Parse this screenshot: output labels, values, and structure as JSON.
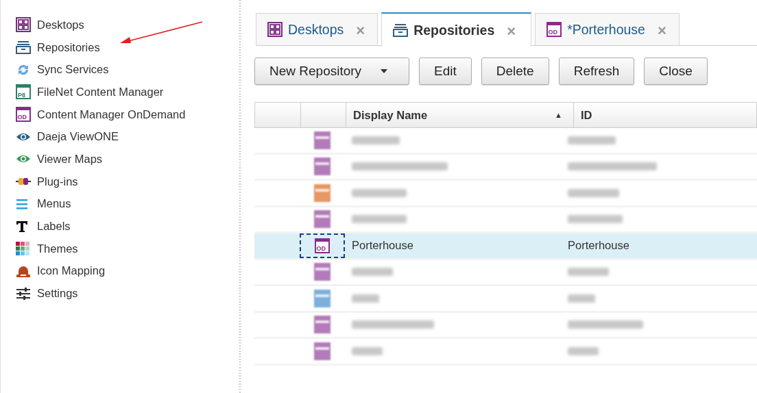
{
  "sidebar": {
    "items": [
      {
        "label": "Desktops",
        "kind": "desktops"
      },
      {
        "label": "Repositories",
        "kind": "repo"
      },
      {
        "label": "Sync Services",
        "kind": "sync"
      },
      {
        "label": "FileNet Content Manager",
        "kind": "p8",
        "icon_text": "P8"
      },
      {
        "label": "Content Manager OnDemand",
        "kind": "od",
        "icon_text": "OD"
      },
      {
        "label": "Daeja ViewONE",
        "kind": "eye"
      },
      {
        "label": "Viewer Maps",
        "kind": "eyegreen"
      },
      {
        "label": "Plug-ins",
        "kind": "plug"
      },
      {
        "label": "Menus",
        "kind": "menu"
      },
      {
        "label": "Labels",
        "kind": "label"
      },
      {
        "label": "Themes",
        "kind": "themes"
      },
      {
        "label": "Icon Mapping",
        "kind": "hat"
      },
      {
        "label": "Settings",
        "kind": "settings"
      }
    ]
  },
  "tabs": [
    {
      "label": "Desktops",
      "close": "×",
      "kind": "desktops",
      "selected": false
    },
    {
      "label": "Repositories",
      "close": "×",
      "kind": "repo",
      "selected": true
    },
    {
      "label": "*Porterhouse",
      "close": "×",
      "kind": "od",
      "icon_text": "OD",
      "selected": false
    }
  ],
  "toolbar": {
    "buttons": [
      {
        "label": "New Repository",
        "kind": "dropdown"
      },
      {
        "label": "Edit",
        "kind": "plain"
      },
      {
        "label": "Delete",
        "kind": "plain"
      },
      {
        "label": "Refresh",
        "kind": "plain"
      },
      {
        "label": "Close",
        "kind": "plain"
      }
    ]
  },
  "table": {
    "columns": [
      {
        "label": "Display Name",
        "sort": "▲"
      },
      {
        "label": "ID"
      }
    ],
    "rows": [
      {
        "kind": "cm",
        "selected": false,
        "redacted": true
      },
      {
        "kind": "cm",
        "selected": false,
        "redacted": true
      },
      {
        "kind": "cmod",
        "selected": false,
        "redacted": true
      },
      {
        "kind": "cm",
        "selected": false,
        "redacted": true
      },
      {
        "kind": "od",
        "icon_text": "OD",
        "selected": true,
        "redacted": false,
        "name": "Porterhouse",
        "id": "Porterhouse"
      },
      {
        "kind": "cm",
        "selected": false,
        "redacted": true
      },
      {
        "kind": "box",
        "selected": false,
        "redacted": true
      },
      {
        "kind": "cm",
        "selected": false,
        "redacted": true
      },
      {
        "kind": "cm",
        "selected": false,
        "redacted": true
      }
    ]
  }
}
